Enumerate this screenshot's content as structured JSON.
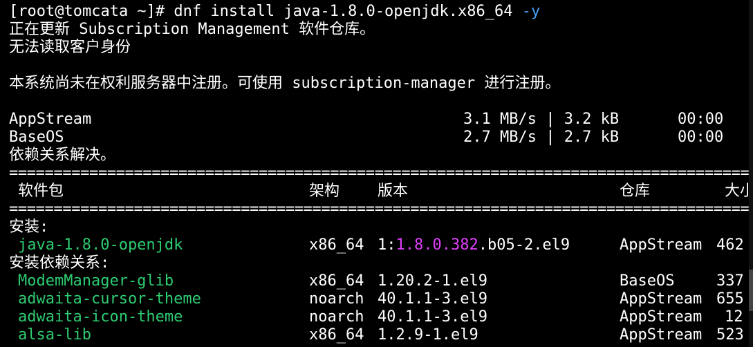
{
  "terminal": {
    "command_prompt": "[root@tomcata ~]# dnf install java-1.8.0-openjdk.x86_64 ",
    "command_flag": "-y",
    "msg_updating": "正在更新 Subscription Management 软件仓库。",
    "msg_identity": "无法读取客户身份",
    "msg_not_registered": "本系统尚未在权利服务器中注册。可使用 subscription-manager 进行注册。",
    "repos": [
      {
        "name": "AppStream",
        "speed": "3.1 MB/s | 3.2 kB",
        "time": "00:00"
      },
      {
        "name": "BaseOS",
        "speed": "2.7 MB/s | 2.7 kB",
        "time": "00:00"
      }
    ],
    "msg_deps_resolved": "依赖关系解决。",
    "separator": "==========================================================================================",
    "headers": {
      "package": "软件包",
      "arch": "架构",
      "version": "版本",
      "repo": "仓库",
      "size": "大小"
    },
    "section_install": "安装:",
    "install_pkg": {
      "name": "java-1.8.0-openjdk",
      "arch": "x86_64",
      "version_prefix": "1:",
      "version_main": "1.8.0.382",
      "version_suffix": ".b05-2.el9",
      "repo": "AppStream",
      "size": "462"
    },
    "section_deps": "安装依赖关系:",
    "dep_pkgs": [
      {
        "name": "ModemManager-glib",
        "arch": "x86_64",
        "version": "1.20.2-1.el9",
        "repo": "BaseOS",
        "size": "337"
      },
      {
        "name": "adwaita-cursor-theme",
        "arch": "noarch",
        "version": "40.1.1-3.el9",
        "repo": "AppStream",
        "size": "655"
      },
      {
        "name": "adwaita-icon-theme",
        "arch": "noarch",
        "version": "40.1.1-3.el9",
        "repo": "AppStream",
        "size": "12"
      },
      {
        "name": "alsa-lib",
        "arch": "x86_64",
        "version": "1.2.9-1.el9",
        "repo": "AppStream",
        "size": "523"
      }
    ],
    "colors": {
      "background": "#000000",
      "text": "#ffffff",
      "package": "#2ecc71",
      "flag": "#4aa3ff",
      "version_highlight": "#e040fb"
    }
  }
}
